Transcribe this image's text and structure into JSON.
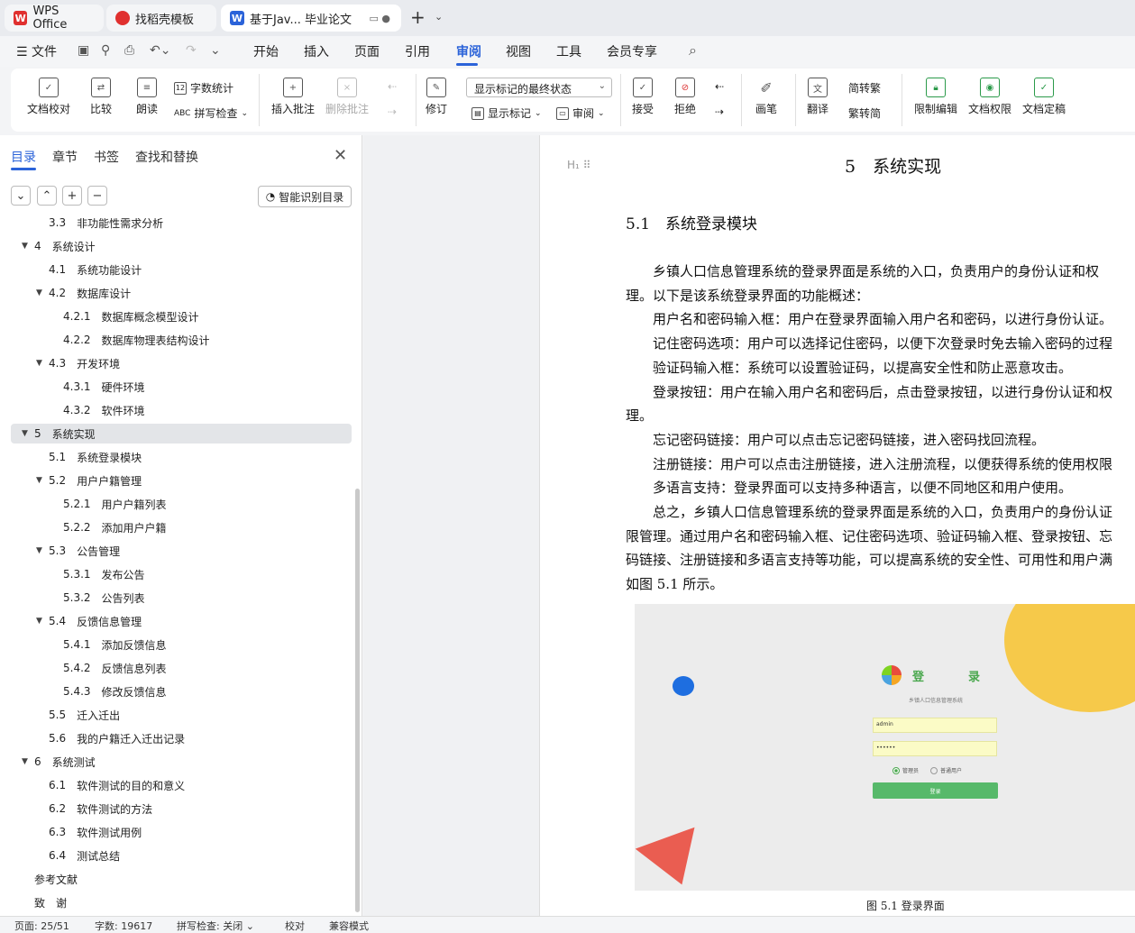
{
  "tabs": [
    {
      "label": "WPS Office",
      "icon": "wps-logo-icon"
    },
    {
      "label": "找稻壳模板",
      "icon": "daoke-logo-icon"
    },
    {
      "label": "基于Jav... 毕业论文",
      "icon": "wps-writer-icon"
    }
  ],
  "menu": {
    "file": "文件",
    "items": [
      "开始",
      "插入",
      "页面",
      "引用",
      "审阅",
      "视图",
      "工具",
      "会员专享"
    ],
    "active": "审阅"
  },
  "ribbon": {
    "proofread": "文档校对",
    "compare": "比较",
    "read_aloud": "朗读",
    "word_count": "字数统计",
    "spell_check": "拼写检查",
    "insert_comment": "插入批注",
    "delete_comment": "删除批注",
    "revise": "修订",
    "markup_state": "显示标记的最终状态",
    "show_markup": "显示标记",
    "review": "审阅",
    "accept": "接受",
    "reject": "拒绝",
    "pen": "画笔",
    "translate": "翻译",
    "to_traditional": "简转繁",
    "to_simplified": "繁转简",
    "restrict_edit": "限制编辑",
    "doc_permission": "文档权限",
    "doc_finalize": "文档定稿"
  },
  "nav": {
    "tabs": [
      "目录",
      "章节",
      "书签",
      "查找和替换"
    ],
    "smart_toc": "智能识别目录",
    "toc": [
      {
        "num": "3.3",
        "text": "非功能性需求分析",
        "level": 2,
        "tri": false,
        "sel": false
      },
      {
        "num": "4",
        "text": "系统设计",
        "level": 1,
        "tri": true,
        "sel": false
      },
      {
        "num": "4.1",
        "text": "系统功能设计",
        "level": 2,
        "tri": false,
        "sel": false
      },
      {
        "num": "4.2",
        "text": "数据库设计",
        "level": 2,
        "tri": true,
        "sel": false
      },
      {
        "num": "4.2.1",
        "text": "数据库概念模型设计",
        "level": 3,
        "tri": false,
        "sel": false
      },
      {
        "num": "4.2.2",
        "text": "数据库物理表结构设计",
        "level": 3,
        "tri": false,
        "sel": false
      },
      {
        "num": "4.3",
        "text": "开发环境",
        "level": 2,
        "tri": true,
        "sel": false
      },
      {
        "num": "4.3.1",
        "text": "硬件环境",
        "level": 3,
        "tri": false,
        "sel": false
      },
      {
        "num": "4.3.2",
        "text": "软件环境",
        "level": 3,
        "tri": false,
        "sel": false
      },
      {
        "num": "5",
        "text": "系统实现",
        "level": 1,
        "tri": true,
        "sel": true
      },
      {
        "num": "5.1",
        "text": "系统登录模块",
        "level": 2,
        "tri": false,
        "sel": false
      },
      {
        "num": "5.2",
        "text": "用户户籍管理",
        "level": 2,
        "tri": true,
        "sel": false
      },
      {
        "num": "5.2.1",
        "text": "用户户籍列表",
        "level": 3,
        "tri": false,
        "sel": false
      },
      {
        "num": "5.2.2",
        "text": "添加用户户籍",
        "level": 3,
        "tri": false,
        "sel": false
      },
      {
        "num": "5.3",
        "text": "公告管理",
        "level": 2,
        "tri": true,
        "sel": false
      },
      {
        "num": "5.3.1",
        "text": "发布公告",
        "level": 3,
        "tri": false,
        "sel": false
      },
      {
        "num": "5.3.2",
        "text": "公告列表",
        "level": 3,
        "tri": false,
        "sel": false
      },
      {
        "num": "5.4",
        "text": "反馈信息管理",
        "level": 2,
        "tri": true,
        "sel": false
      },
      {
        "num": "5.4.1",
        "text": "添加反馈信息",
        "level": 3,
        "tri": false,
        "sel": false
      },
      {
        "num": "5.4.2",
        "text": "反馈信息列表",
        "level": 3,
        "tri": false,
        "sel": false
      },
      {
        "num": "5.4.3",
        "text": "修改反馈信息",
        "level": 3,
        "tri": false,
        "sel": false
      },
      {
        "num": "5.5",
        "text": "迁入迁出",
        "level": 2,
        "tri": false,
        "sel": false
      },
      {
        "num": "5.6",
        "text": "我的户籍迁入迁出记录",
        "level": 2,
        "tri": false,
        "sel": false
      },
      {
        "num": "6",
        "text": "系统测试",
        "level": 1,
        "tri": true,
        "sel": false
      },
      {
        "num": "6.1",
        "text": "软件测试的目的和意义",
        "level": 2,
        "tri": false,
        "sel": false
      },
      {
        "num": "6.2",
        "text": "软件测试的方法",
        "level": 2,
        "tri": false,
        "sel": false
      },
      {
        "num": "6.3",
        "text": "软件测试用例",
        "level": 2,
        "tri": false,
        "sel": false
      },
      {
        "num": "6.4",
        "text": "测试总结",
        "level": 2,
        "tri": false,
        "sel": false
      },
      {
        "num": "",
        "text": "参考文献",
        "level": 0,
        "tri": false,
        "sel": false
      },
      {
        "num": "",
        "text": "致　谢",
        "level": 0,
        "tri": false,
        "sel": false
      }
    ]
  },
  "doc": {
    "heading1": "5　系统实现",
    "heading2": "5.1　系统登录模块",
    "lines": [
      "　　乡镇人口信息管理系统的登录界面是系统的入口，负责用户的身份认证和权",
      "理。以下是该系统登录界面的功能概述：",
      "　　用户名和密码输入框：用户在登录界面输入用户名和密码，以进行身份认证。",
      "　　记住密码选项：用户可以选择记住密码，以便下次登录时免去输入密码的过程",
      "　　验证码输入框：系统可以设置验证码，以提高安全性和防止恶意攻击。",
      "　　登录按钮：用户在输入用户名和密码后，点击登录按钮，以进行身份认证和权",
      "理。",
      "　　忘记密码链接：用户可以点击忘记密码链接，进入密码找回流程。",
      "　　注册链接：用户可以点击注册链接，进入注册流程，以便获得系统的使用权限",
      "　　多语言支持：登录界面可以支持多种语言，以便不同地区和用户使用。",
      "　　总之，乡镇人口信息管理系统的登录界面是系统的入口，负责用户的身份认证",
      "限管理。通过用户名和密码输入框、记住密码选项、验证码输入框、登录按钮、忘",
      "码链接、注册链接和多语言支持等功能，可以提高系统的安全性、可用性和用户满",
      "如图 5.1 所示。"
    ],
    "figure": {
      "title": "登　录",
      "subtitle": "乡镇人口信息管理系统",
      "username": "admin",
      "password": "••••••",
      "role_admin": "管理员",
      "role_user": "普通用户",
      "login_button": "登录"
    },
    "caption": "图 5.1  登录界面"
  },
  "status": {
    "page": "页面: 25/51",
    "words": "字数: 19617",
    "spell": "拼写检查: 关闭",
    "proof": "校对",
    "compat": "兼容模式"
  }
}
